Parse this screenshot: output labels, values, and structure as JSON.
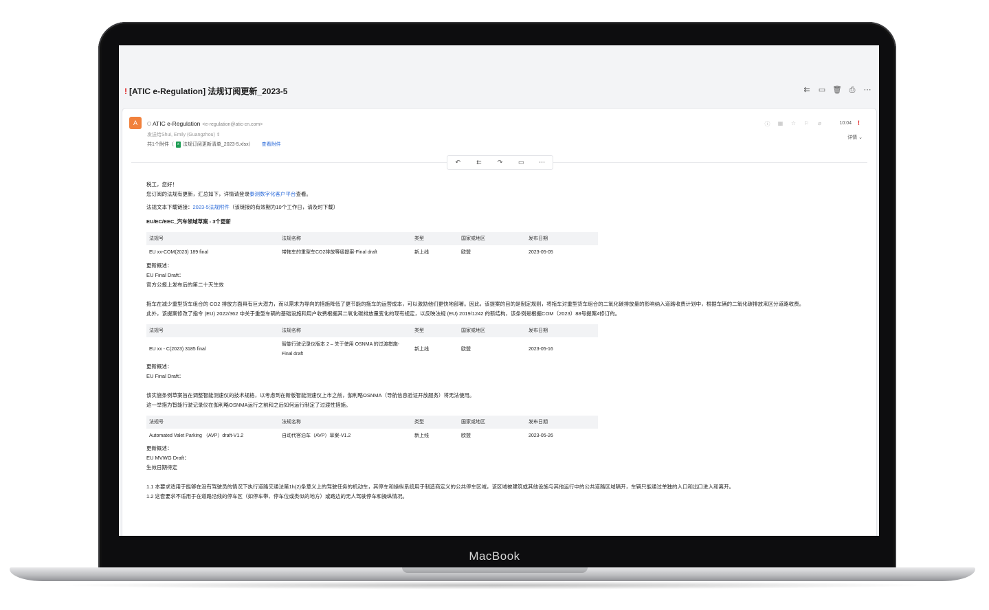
{
  "device": {
    "brand": "MacBook"
  },
  "email": {
    "subject_flag": "!",
    "subject": "[ATIC e-Regulation] 法规订阅更新_2023-5",
    "toolbar_icons": [
      "reply-all-icon",
      "move-to-folder-icon",
      "delete-icon",
      "print-icon",
      "more-icon"
    ],
    "sender": {
      "avatar": "A",
      "name": "ATIC e-Regulation",
      "address": "<e-regulation@atic-cn.com>",
      "sent_to": "发送给Shui, Emily (Guangzhou) ⇕",
      "attachment_prefix": "共1个附件（",
      "attachment_name": "法规订阅更新清单_2023-5.xlsx）",
      "view_attachment": "查看附件",
      "time": "10:04",
      "priority": "!",
      "details": "详情 ⌄"
    },
    "action_buttons": [
      "reply",
      "reply-all",
      "forward",
      "video",
      "more"
    ],
    "body": {
      "greeting": "税工，您好！",
      "intro_prefix": "您订阅的法规有更新，汇总如下，详情请登录",
      "intro_link": "泰测数字化客户平台",
      "intro_suffix": "查看。",
      "download_prefix": "法规文本下载链接：",
      "download_link": "2023-5法规附件",
      "download_suffix": "（该链接的有效期为10个工作日，请及时下载）",
      "section_title": "EU/EC/EEC_汽车领域草案 - 3个更新",
      "headers": [
        "法规号",
        "法规名称",
        "类型",
        "国家或地区",
        "发布日期"
      ],
      "items": [
        {
          "row": [
            "EU xx-COM(2023) 189 final",
            "带拖车的重型车CO2排放等级提案-Final draft",
            "新上线",
            "欧盟",
            "2023-05-05"
          ],
          "summary_label": "更新概述：",
          "draft_label": "EU Final Draft：",
          "draft_note": "官方公报上发布后的第二十天生效",
          "para": [
            "拖车在减少重型货车组合的 CO2 排放方面具有巨大潜力，而以需求为导向的措施降低了更节能的拖车的运营成本，可以激励他们更快地部署。因此，该提案的目的是制定规则，将拖车对重型货车组合的二氧化碳排放量的影响纳入道路收费计划中，根据车辆的二氧化碳排放来区分道路收费。",
            "此外，该提案修改了指令 (EU) 2022/362 中关于重型车辆的基础设施和用户收费根据其二氧化碳排放量变化的现有规定，以反映法规 (EU) 2019/1242 的新结构，该条例是根据COM（2023）88号提案4修订的。"
          ]
        },
        {
          "row": [
            "EU xx - C(2023) 3185 final",
            "智能行驶记录仪版本 2 – 关于使用 OSNMA 的过渡措施-Final draft",
            "新上线",
            "欧盟",
            "2023-05-16"
          ],
          "summary_label": "更新概述：",
          "draft_label": "EU Final Draft：",
          "draft_note": "",
          "para": [
            "该实施条例草案旨在调整智能测速仪的技术规格，以考虑到在新版智能测速仪上市之前，伽利略OSNMA（导航信息验证开放服务）将无法使用。",
            "这一举措为智能行驶记录仪在伽利略OSNMA运行之前和之后如何运行制定了过渡性措施。"
          ]
        },
        {
          "row": [
            "Automated Valet Parking （AVP）draft-V1.2",
            "自动代客泊车（AVP）草案-V1.2",
            "新上线",
            "欧盟",
            "2023-05-26"
          ],
          "summary_label": "更新概述：",
          "draft_label": "EU MVWG Draft：",
          "draft_note": "生效日期待定",
          "para": [
            "1.1 本要求适用于能够在没有驾驶员的情况下执行道路交通法第1h(2)条意义上的驾驶任务的机动车，其停车和操纵系统用于制造商定义的公共停车区域，该区域被建筑或其他设施与其他运行中的公共道路区域隔开，车辆只能通过单独的入口和出口进入和离开。",
            "1.2 这套要求不适用于在道路沿线的停车区（如停车带、停车位或类似的地方）或路边的无人驾驶停车和操纵情况。"
          ]
        }
      ]
    }
  }
}
